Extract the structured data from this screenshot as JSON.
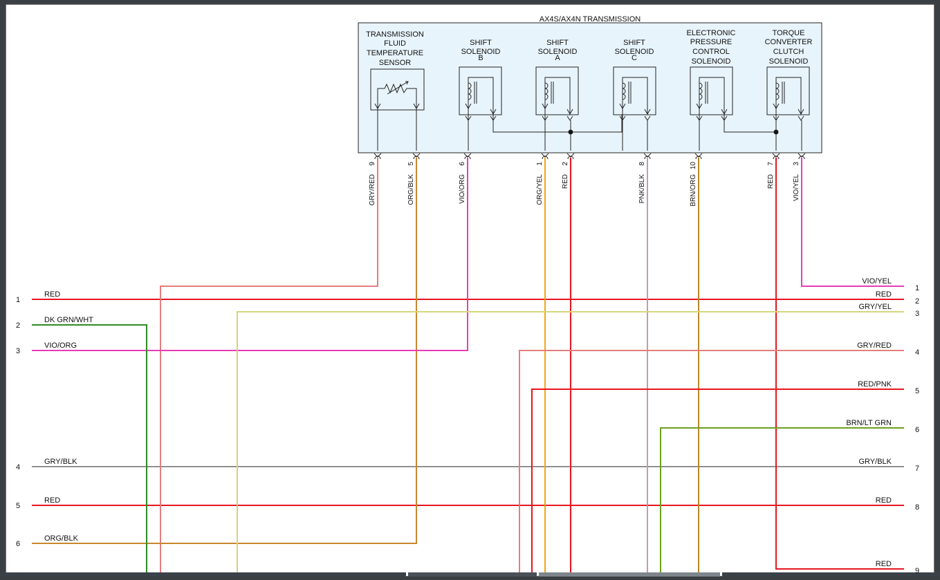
{
  "diagram": {
    "title": "AX4S/AX4N TRANSMISSION",
    "components": [
      {
        "id": "tft",
        "lines": [
          "TRANSMISSION",
          "FLUID",
          "TEMPERATURE",
          "SENSOR"
        ]
      },
      {
        "id": "ssb",
        "lines": [
          "SHIFT",
          "SOLENOID",
          "B"
        ]
      },
      {
        "id": "ssa",
        "lines": [
          "SHIFT",
          "SOLENOID",
          "A"
        ]
      },
      {
        "id": "ssc",
        "lines": [
          "SHIFT",
          "SOLENOID",
          "C"
        ]
      },
      {
        "id": "epc",
        "lines": [
          "ELECTRONIC",
          "PRESSURE",
          "CONTROL",
          "SOLENOID"
        ]
      },
      {
        "id": "tcc",
        "lines": [
          "TORQUE",
          "CONVERTER",
          "CLUTCH",
          "SOLENOID"
        ]
      }
    ],
    "connector_pins": [
      {
        "pin": "9",
        "color": "GRY/RED"
      },
      {
        "pin": "5",
        "color": "ORG/BLK"
      },
      {
        "pin": "6",
        "color": "VIO/ORG"
      },
      {
        "pin": "1",
        "color": "ORG/YEL"
      },
      {
        "pin": "2",
        "color": "RED"
      },
      {
        "pin": "8",
        "color": "PNK/BLK"
      },
      {
        "pin": "10",
        "color": "BRN/ORG"
      },
      {
        "pin": "7",
        "color": "RED"
      },
      {
        "pin": "3",
        "color": "VIO/YEL"
      }
    ],
    "left_wires": [
      {
        "pin": "1",
        "label": "RED"
      },
      {
        "pin": "2",
        "label": "DK GRN/WHT"
      },
      {
        "pin": "3",
        "label": "VIO/ORG"
      },
      {
        "pin": "4",
        "label": "GRY/BLK"
      },
      {
        "pin": "5",
        "label": "RED"
      },
      {
        "pin": "6",
        "label": "ORG/BLK"
      }
    ],
    "right_wires": [
      {
        "pin": "1",
        "label": "VIO/YEL"
      },
      {
        "pin": "2",
        "label": "RED"
      },
      {
        "pin": "3",
        "label": "GRY/YEL"
      },
      {
        "pin": "4",
        "label": "GRY/RED"
      },
      {
        "pin": "5",
        "label": "RED/PNK"
      },
      {
        "pin": "6",
        "label": "BRN/LT GRN"
      },
      {
        "pin": "7",
        "label": "GRY/BLK"
      },
      {
        "pin": "8",
        "label": "RED"
      },
      {
        "pin": "9",
        "label": "RED"
      }
    ],
    "wire_colors": {
      "red": "#e8141e",
      "pink_red": "#e47d7d",
      "org_blk": "#c8862e",
      "magenta": "#e63cb4",
      "org_yel": "#f0a818",
      "pnk_blk": "#c897b4",
      "brn_org": "#b8862a",
      "gry_yel": "#d6d67a",
      "dk_grn": "#2e8a22",
      "brn_lt_grn": "#6aa020",
      "gray": "#909090",
      "box_fill": "#e8f4fb"
    }
  }
}
